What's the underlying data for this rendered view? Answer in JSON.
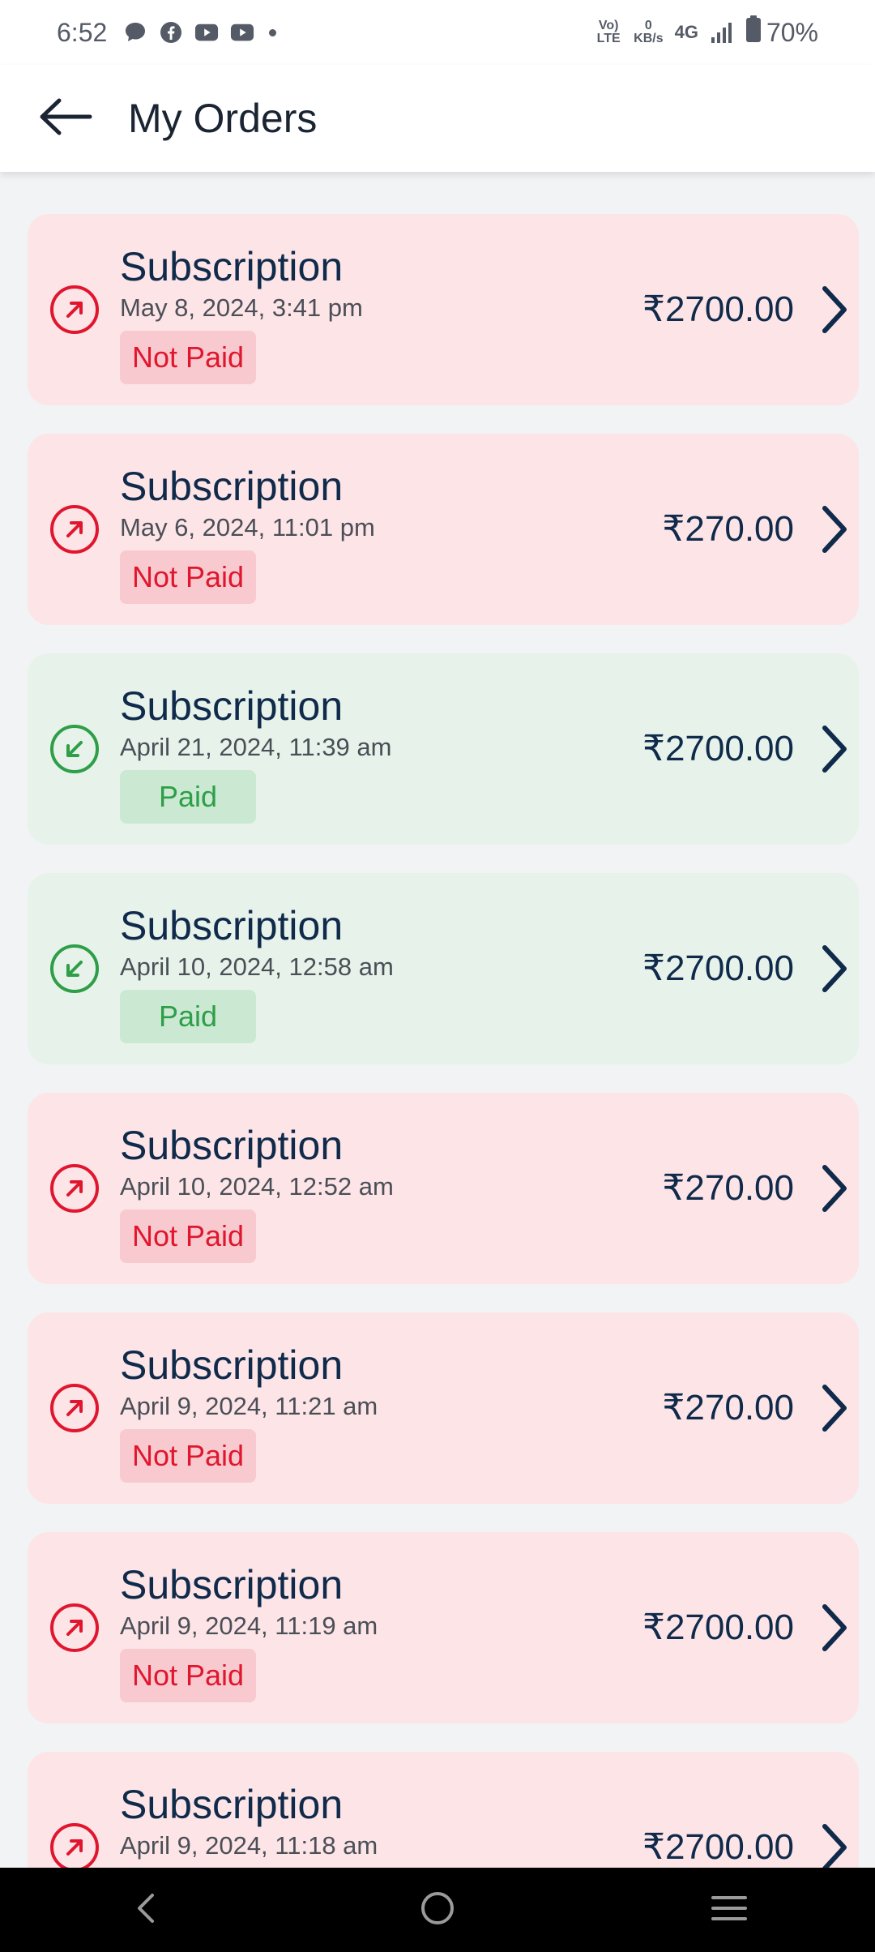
{
  "status_bar": {
    "time": "6:52",
    "notification_icons": [
      "chat-bubble-icon",
      "facebook-icon",
      "youtube-icon",
      "youtube-icon",
      "more-dot-icon"
    ],
    "volte_label": "Vo) LTE",
    "data_speed_value": "0",
    "data_speed_unit": "KB/s",
    "network_type": "4G",
    "battery_percent": "70%"
  },
  "header": {
    "title": "My Orders",
    "back_icon": "arrow-left-icon"
  },
  "orders": [
    {
      "title": "Subscription",
      "date": "May 8, 2024, 3:41 pm",
      "status": "Not Paid",
      "amount": "₹2700.00",
      "paid": false
    },
    {
      "title": "Subscription",
      "date": "May 6, 2024, 11:01 pm",
      "status": "Not Paid",
      "amount": "₹270.00",
      "paid": false
    },
    {
      "title": "Subscription",
      "date": "April 21, 2024, 11:39 am",
      "status": "Paid",
      "amount": "₹2700.00",
      "paid": true
    },
    {
      "title": "Subscription",
      "date": "April 10, 2024, 12:58 am",
      "status": "Paid",
      "amount": "₹2700.00",
      "paid": true
    },
    {
      "title": "Subscription",
      "date": "April 10, 2024, 12:52 am",
      "status": "Not Paid",
      "amount": "₹270.00",
      "paid": false
    },
    {
      "title": "Subscription",
      "date": "April 9, 2024, 11:21 am",
      "status": "Not Paid",
      "amount": "₹270.00",
      "paid": false
    },
    {
      "title": "Subscription",
      "date": "April 9, 2024, 11:19 am",
      "status": "Not Paid",
      "amount": "₹2700.00",
      "paid": false
    },
    {
      "title": "Subscription",
      "date": "April 9, 2024, 11:18 am",
      "status": "",
      "amount": "₹2700.00",
      "paid": false
    }
  ],
  "colors": {
    "unpaid_card": "#fde4e7",
    "unpaid_accent": "#e0162e",
    "paid_card": "#e7f3ea",
    "paid_accent": "#2e9e48",
    "text_primary": "#0f2a4a"
  },
  "nav_bar": {
    "icons": [
      "back-nav-icon",
      "home-nav-icon",
      "recents-nav-icon"
    ]
  }
}
